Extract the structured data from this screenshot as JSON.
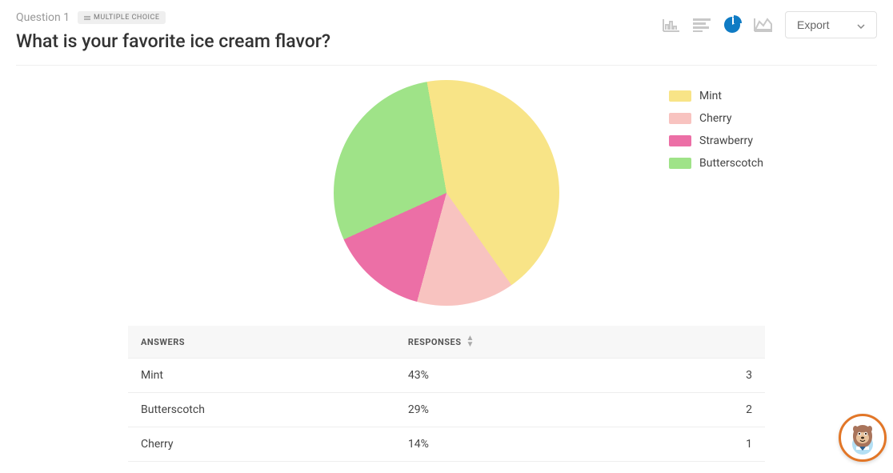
{
  "header": {
    "question_number": "Question 1",
    "question_type": "MULTIPLE CHOICE",
    "title": "What is your favorite ice cream flavor?",
    "export_label": "Export"
  },
  "chart_data": {
    "type": "pie",
    "title": "",
    "series": [
      {
        "name": "Mint",
        "value": 43,
        "color": "#F8E487"
      },
      {
        "name": "Cherry",
        "value": 14,
        "color": "#F8C3C0"
      },
      {
        "name": "Strawberry",
        "value": 14,
        "color": "#EC6FA6"
      },
      {
        "name": "Butterscotch",
        "value": 29,
        "color": "#9FE388"
      }
    ],
    "legend_order": [
      "Mint",
      "Cherry",
      "Strawberry",
      "Butterscotch"
    ]
  },
  "table": {
    "headers": {
      "answers": "ANSWERS",
      "responses": "RESPONSES"
    },
    "rows": [
      {
        "answer": "Mint",
        "percent": "43%",
        "count": "3"
      },
      {
        "answer": "Butterscotch",
        "percent": "29%",
        "count": "2"
      },
      {
        "answer": "Cherry",
        "percent": "14%",
        "count": "1"
      }
    ]
  },
  "colors": {
    "accent": "#0F7BC4",
    "widget_border": "#E27627"
  }
}
